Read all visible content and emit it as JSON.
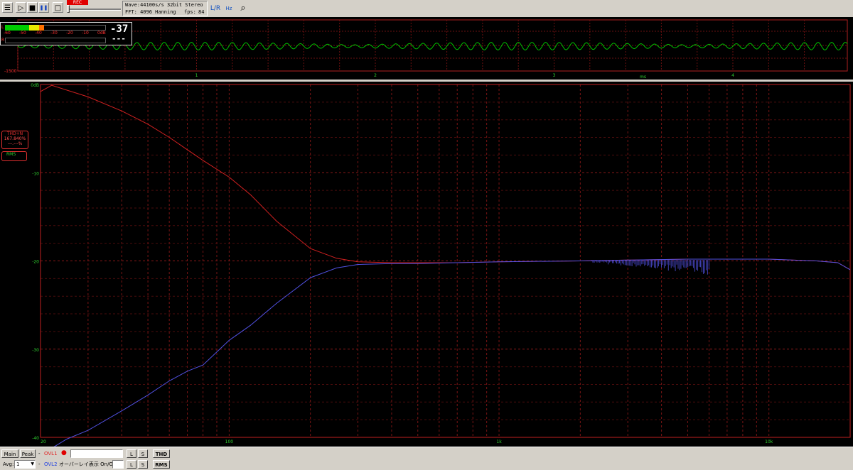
{
  "toolbar": {
    "buttons": [
      "☰",
      "▷",
      "■",
      "❚❚",
      "□"
    ],
    "rec_badge": "REC",
    "info_line1": "Wave:44100s/s 32bit Stereo",
    "fft_label": "FFT: 4096 Hanning",
    "fps_label": "fps:",
    "fps_value": "84",
    "icon1": "L/R",
    "icon2": "Hz dB",
    "icon3": "⌕"
  },
  "waveform": {
    "y_top": "",
    "y_bottom": "-1500",
    "x_ticks": [
      "1",
      "2",
      "3",
      "4"
    ],
    "x_unit": "ms",
    "trace_color": "#00c000"
  },
  "meter": {
    "scale": [
      "-60",
      "-50",
      "-40",
      "-30",
      "-20",
      "-10",
      "0dB"
    ],
    "channel_l": "L",
    "channel_r": "R",
    "level_l_fraction": 0.39,
    "peak_value": "-37",
    "peak_value_r": "---"
  },
  "side": {
    "thd_label": "THD+N",
    "thd_value": "167.840%",
    "thd_value2": "---.---%",
    "rms_label": "RMS"
  },
  "chart_data": {
    "type": "line",
    "xscale": "log",
    "xlim": [
      20,
      20000
    ],
    "ylim": [
      -40,
      0
    ],
    "xtick_labels": [
      {
        "x": 20,
        "label": "20"
      },
      {
        "x": 100,
        "label": "100"
      },
      {
        "x": 1000,
        "label": "1k"
      },
      {
        "x": 10000,
        "label": "10k"
      }
    ],
    "ytick_labels": [
      {
        "y": 0,
        "label": "0dB"
      },
      {
        "y": -10,
        "label": "-10"
      },
      {
        "y": -20,
        "label": "-20"
      },
      {
        "y": -30,
        "label": "-30"
      },
      {
        "y": -40,
        "label": "-40"
      }
    ],
    "grid": true,
    "series": [
      {
        "color": "#d02020",
        "x": [
          20,
          22,
          30,
          40,
          50,
          60,
          70,
          80,
          100,
          120,
          150,
          200,
          250,
          300,
          400,
          500,
          700,
          1000,
          2000,
          3000,
          5000,
          7000,
          10000,
          15000,
          18000,
          20000
        ],
        "y": [
          -0.8,
          -0.1,
          -1.4,
          -3.0,
          -4.5,
          -6.0,
          -7.4,
          -8.6,
          -10.5,
          -12.5,
          -15.5,
          -18.6,
          -19.7,
          -20.1,
          -20.2,
          -20.2,
          -20.2,
          -20.1,
          -20.0,
          -19.9,
          -19.8,
          -19.8,
          -19.8,
          -20.0,
          -20.2,
          -21.0
        ]
      },
      {
        "color": "#5050e0",
        "x": [
          20,
          25,
          30,
          40,
          50,
          60,
          70,
          80,
          100,
          120,
          150,
          200,
          250,
          300,
          400,
          500,
          700,
          1000,
          2000,
          3000,
          5000,
          7000,
          10000,
          15000,
          18000,
          20000
        ],
        "y": [
          -42,
          -40.2,
          -39.2,
          -37.0,
          -35.2,
          -33.6,
          -32.5,
          -31.8,
          -29.0,
          -27.3,
          -24.8,
          -21.9,
          -20.8,
          -20.4,
          -20.3,
          -20.3,
          -20.2,
          -20.1,
          -20.0,
          -19.9,
          -19.8,
          -19.8,
          -19.8,
          -20.0,
          -20.2,
          -21.0
        ]
      }
    ]
  },
  "bottom": {
    "main_label": "Main",
    "peak_label": "Peak",
    "dash": "-",
    "ovl1_label": "OVL1",
    "ovl2_label": "OVL2",
    "overlay_text": "オーバーレイ表示 On/Off",
    "avg_label": "Avg:",
    "avg_value": "1",
    "l_label": "L",
    "s_label": "S",
    "thd_button": "THD",
    "rms_button": "RMS"
  }
}
